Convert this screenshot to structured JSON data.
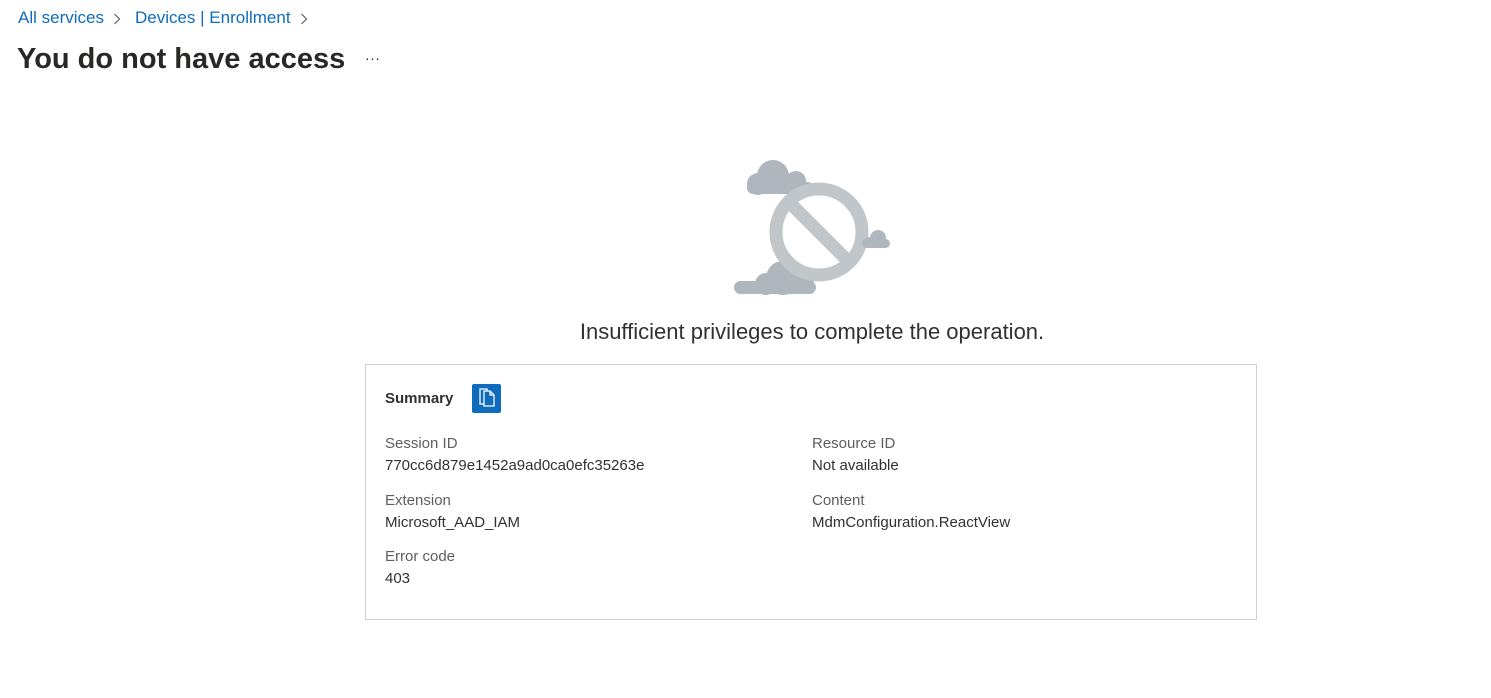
{
  "breadcrumb": {
    "items": [
      {
        "label": "All services"
      },
      {
        "label": "Devices | Enrollment"
      }
    ]
  },
  "page": {
    "title": "You do not have access",
    "more_label": "···"
  },
  "message": "Insufficient privileges to complete the operation.",
  "summary": {
    "title": "Summary",
    "fields": {
      "session_id": {
        "label": "Session ID",
        "value": "770cc6d879e1452a9ad0ca0efc35263e"
      },
      "resource_id": {
        "label": "Resource ID",
        "value": "Not available"
      },
      "extension": {
        "label": "Extension",
        "value": "Microsoft_AAD_IAM"
      },
      "content": {
        "label": "Content",
        "value": "MdmConfiguration.ReactView"
      },
      "error_code": {
        "label": "Error code",
        "value": "403"
      }
    }
  },
  "icons": {
    "copy": "copy-icon",
    "chevron": "chevron-right-icon",
    "illustration": "access-denied-illustration"
  },
  "colors": {
    "link": "#0f6cbd",
    "accent": "#0f6cbd",
    "illustration_gray": "#b9bec4",
    "border": "#d2d0ce"
  }
}
